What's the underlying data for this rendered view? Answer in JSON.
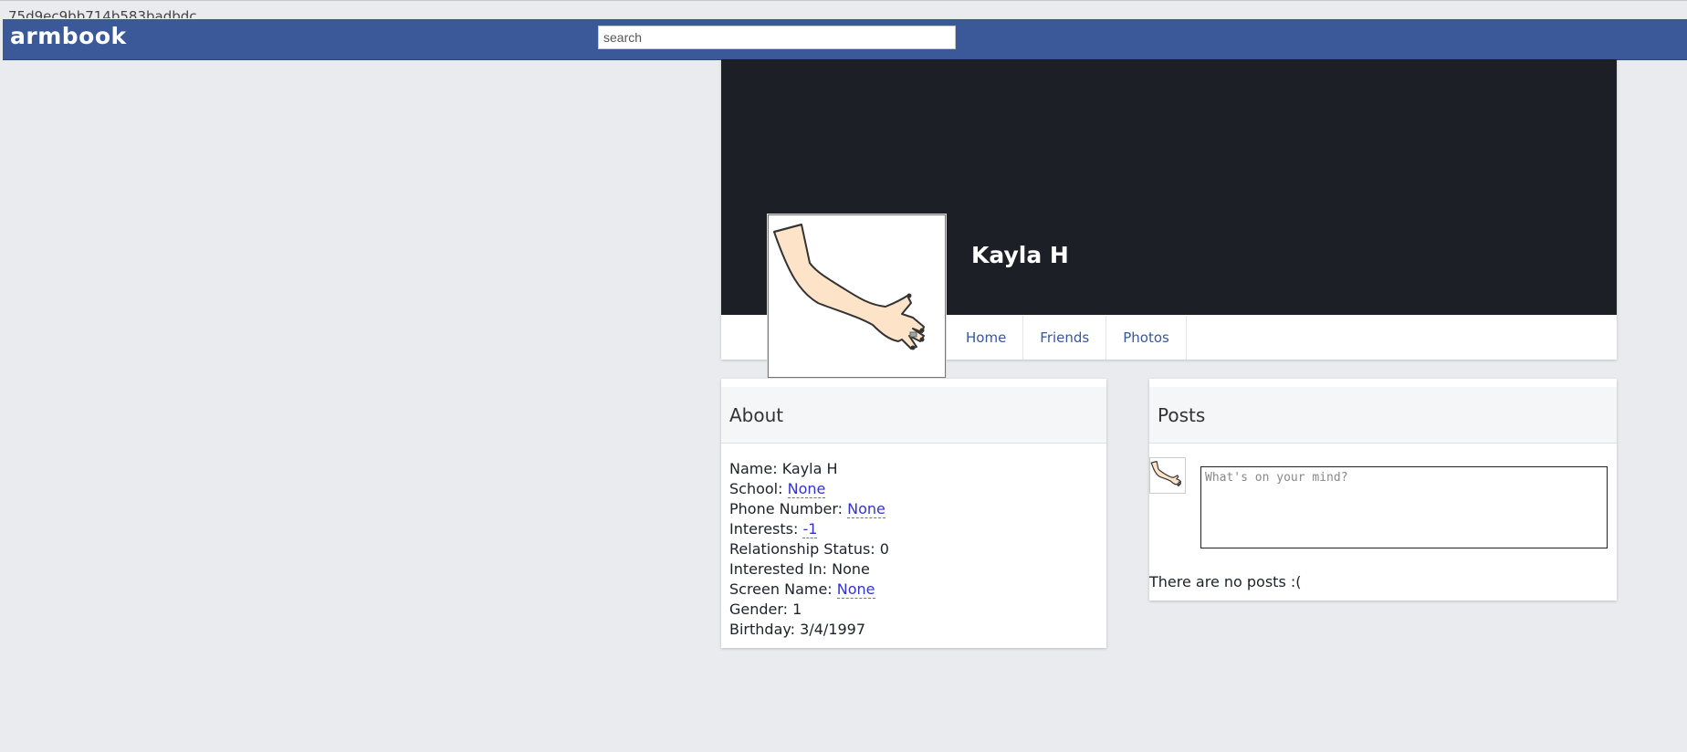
{
  "header": {
    "hash_text": "75d9ec9bb714b583badbdc",
    "logo": "armbook",
    "search_placeholder": "search"
  },
  "profile": {
    "name": "Kayla H",
    "tabs": [
      {
        "label": "Home"
      },
      {
        "label": "Friends"
      },
      {
        "label": "Photos"
      }
    ]
  },
  "about": {
    "title": "About",
    "fields": [
      {
        "label": "Name:",
        "value": "Kayla H",
        "link": false
      },
      {
        "label": "School:",
        "value": "None",
        "link": true
      },
      {
        "label": "Phone Number:",
        "value": "None",
        "link": true
      },
      {
        "label": "Interests:",
        "value": "-1",
        "link": true
      },
      {
        "label": "Relationship Status:",
        "value": "0",
        "link": false
      },
      {
        "label": "Interested In:",
        "value": "None",
        "link": false
      },
      {
        "label": "Screen Name:",
        "value": "None",
        "link": true
      },
      {
        "label": "Gender:",
        "value": "1",
        "link": false
      },
      {
        "label": "Birthday:",
        "value": "3/4/1997",
        "link": false
      }
    ]
  },
  "posts": {
    "title": "Posts",
    "input_placeholder": "What's on your mind?",
    "empty_text": "There are no posts :("
  },
  "colors": {
    "navbar": "#3b5998",
    "cover": "#1d1f27",
    "page_bg": "#e9ebee",
    "link": "#3333cc"
  },
  "icons": {
    "profile_picture": "arm-hand-icon",
    "post_avatar": "arm-hand-icon"
  }
}
